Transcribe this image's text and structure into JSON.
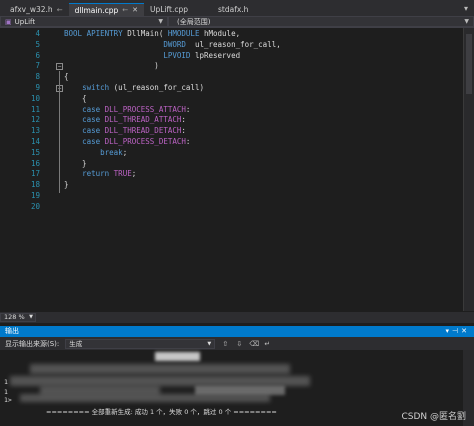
{
  "tabs": [
    {
      "label": "afxv_w32.h",
      "pin": "←",
      "active": false
    },
    {
      "label": "dllmain.cpp",
      "pin": "←",
      "close": "✕",
      "active": true
    },
    {
      "label": "UpLift.cpp",
      "active": false
    },
    {
      "label": "stdafx.h",
      "active": false
    }
  ],
  "tab_overflow": "▾",
  "nav": {
    "project": "UpLift",
    "scope": "(全局范围)"
  },
  "code_lines": [
    {
      "num": "4",
      "text": "BOOL APIENTRY DllMain( HMODULE hModule,"
    },
    {
      "num": "5",
      "text": "                      DWORD  ul_reason_for_call,"
    },
    {
      "num": "6",
      "text": "                      LPVOID lpReserved"
    },
    {
      "num": "7",
      "text": "                    )"
    },
    {
      "num": "8",
      "text": "{"
    },
    {
      "num": "9",
      "text": "    switch (ul_reason_for_call)"
    },
    {
      "num": "10",
      "text": "    {"
    },
    {
      "num": "11",
      "text": "    case DLL_PROCESS_ATTACH:"
    },
    {
      "num": "12",
      "text": "    case DLL_THREAD_ATTACH:"
    },
    {
      "num": "13",
      "text": "    case DLL_THREAD_DETACH:"
    },
    {
      "num": "14",
      "text": "    case DLL_PROCESS_DETACH:"
    },
    {
      "num": "15",
      "text": "        break;"
    },
    {
      "num": "16",
      "text": "    }"
    },
    {
      "num": "17",
      "text": "    return TRUE;"
    },
    {
      "num": "18",
      "text": "}"
    },
    {
      "num": "19",
      "text": ""
    },
    {
      "num": "20",
      "text": ""
    }
  ],
  "zoom": "128 %",
  "output": {
    "title": "输出",
    "source_label": "显示输出来源(S):",
    "source_value": "生成",
    "lines": [
      "1",
      "1",
      "1>"
    ],
    "summary": "======== 全部重新生成: 成功 1 个，失败 0 个，跳过 0 个 ========"
  },
  "watermark": "CSDN @匿名劉",
  "colors": {
    "accent": "#007acc",
    "keyword": "#569cd6",
    "type": "#4ec9b0",
    "macro": "#bd63c5",
    "line_number": "#2b91af"
  }
}
